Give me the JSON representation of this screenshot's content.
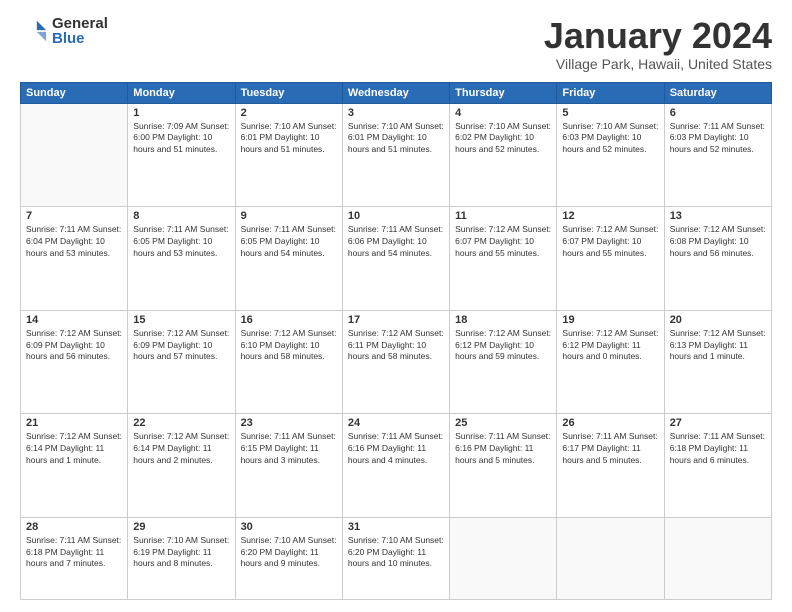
{
  "logo": {
    "general": "General",
    "blue": "Blue"
  },
  "title": "January 2024",
  "subtitle": "Village Park, Hawaii, United States",
  "days_of_week": [
    "Sunday",
    "Monday",
    "Tuesday",
    "Wednesday",
    "Thursday",
    "Friday",
    "Saturday"
  ],
  "weeks": [
    [
      {
        "num": "",
        "info": ""
      },
      {
        "num": "1",
        "info": "Sunrise: 7:09 AM\nSunset: 6:00 PM\nDaylight: 10 hours\nand 51 minutes."
      },
      {
        "num": "2",
        "info": "Sunrise: 7:10 AM\nSunset: 6:01 PM\nDaylight: 10 hours\nand 51 minutes."
      },
      {
        "num": "3",
        "info": "Sunrise: 7:10 AM\nSunset: 6:01 PM\nDaylight: 10 hours\nand 51 minutes."
      },
      {
        "num": "4",
        "info": "Sunrise: 7:10 AM\nSunset: 6:02 PM\nDaylight: 10 hours\nand 52 minutes."
      },
      {
        "num": "5",
        "info": "Sunrise: 7:10 AM\nSunset: 6:03 PM\nDaylight: 10 hours\nand 52 minutes."
      },
      {
        "num": "6",
        "info": "Sunrise: 7:11 AM\nSunset: 6:03 PM\nDaylight: 10 hours\nand 52 minutes."
      }
    ],
    [
      {
        "num": "7",
        "info": "Sunrise: 7:11 AM\nSunset: 6:04 PM\nDaylight: 10 hours\nand 53 minutes."
      },
      {
        "num": "8",
        "info": "Sunrise: 7:11 AM\nSunset: 6:05 PM\nDaylight: 10 hours\nand 53 minutes."
      },
      {
        "num": "9",
        "info": "Sunrise: 7:11 AM\nSunset: 6:05 PM\nDaylight: 10 hours\nand 54 minutes."
      },
      {
        "num": "10",
        "info": "Sunrise: 7:11 AM\nSunset: 6:06 PM\nDaylight: 10 hours\nand 54 minutes."
      },
      {
        "num": "11",
        "info": "Sunrise: 7:12 AM\nSunset: 6:07 PM\nDaylight: 10 hours\nand 55 minutes."
      },
      {
        "num": "12",
        "info": "Sunrise: 7:12 AM\nSunset: 6:07 PM\nDaylight: 10 hours\nand 55 minutes."
      },
      {
        "num": "13",
        "info": "Sunrise: 7:12 AM\nSunset: 6:08 PM\nDaylight: 10 hours\nand 56 minutes."
      }
    ],
    [
      {
        "num": "14",
        "info": "Sunrise: 7:12 AM\nSunset: 6:09 PM\nDaylight: 10 hours\nand 56 minutes."
      },
      {
        "num": "15",
        "info": "Sunrise: 7:12 AM\nSunset: 6:09 PM\nDaylight: 10 hours\nand 57 minutes."
      },
      {
        "num": "16",
        "info": "Sunrise: 7:12 AM\nSunset: 6:10 PM\nDaylight: 10 hours\nand 58 minutes."
      },
      {
        "num": "17",
        "info": "Sunrise: 7:12 AM\nSunset: 6:11 PM\nDaylight: 10 hours\nand 58 minutes."
      },
      {
        "num": "18",
        "info": "Sunrise: 7:12 AM\nSunset: 6:12 PM\nDaylight: 10 hours\nand 59 minutes."
      },
      {
        "num": "19",
        "info": "Sunrise: 7:12 AM\nSunset: 6:12 PM\nDaylight: 11 hours\nand 0 minutes."
      },
      {
        "num": "20",
        "info": "Sunrise: 7:12 AM\nSunset: 6:13 PM\nDaylight: 11 hours\nand 1 minute."
      }
    ],
    [
      {
        "num": "21",
        "info": "Sunrise: 7:12 AM\nSunset: 6:14 PM\nDaylight: 11 hours\nand 1 minute."
      },
      {
        "num": "22",
        "info": "Sunrise: 7:12 AM\nSunset: 6:14 PM\nDaylight: 11 hours\nand 2 minutes."
      },
      {
        "num": "23",
        "info": "Sunrise: 7:11 AM\nSunset: 6:15 PM\nDaylight: 11 hours\nand 3 minutes."
      },
      {
        "num": "24",
        "info": "Sunrise: 7:11 AM\nSunset: 6:16 PM\nDaylight: 11 hours\nand 4 minutes."
      },
      {
        "num": "25",
        "info": "Sunrise: 7:11 AM\nSunset: 6:16 PM\nDaylight: 11 hours\nand 5 minutes."
      },
      {
        "num": "26",
        "info": "Sunrise: 7:11 AM\nSunset: 6:17 PM\nDaylight: 11 hours\nand 5 minutes."
      },
      {
        "num": "27",
        "info": "Sunrise: 7:11 AM\nSunset: 6:18 PM\nDaylight: 11 hours\nand 6 minutes."
      }
    ],
    [
      {
        "num": "28",
        "info": "Sunrise: 7:11 AM\nSunset: 6:18 PM\nDaylight: 11 hours\nand 7 minutes."
      },
      {
        "num": "29",
        "info": "Sunrise: 7:10 AM\nSunset: 6:19 PM\nDaylight: 11 hours\nand 8 minutes."
      },
      {
        "num": "30",
        "info": "Sunrise: 7:10 AM\nSunset: 6:20 PM\nDaylight: 11 hours\nand 9 minutes."
      },
      {
        "num": "31",
        "info": "Sunrise: 7:10 AM\nSunset: 6:20 PM\nDaylight: 11 hours\nand 10 minutes."
      },
      {
        "num": "",
        "info": ""
      },
      {
        "num": "",
        "info": ""
      },
      {
        "num": "",
        "info": ""
      }
    ]
  ]
}
